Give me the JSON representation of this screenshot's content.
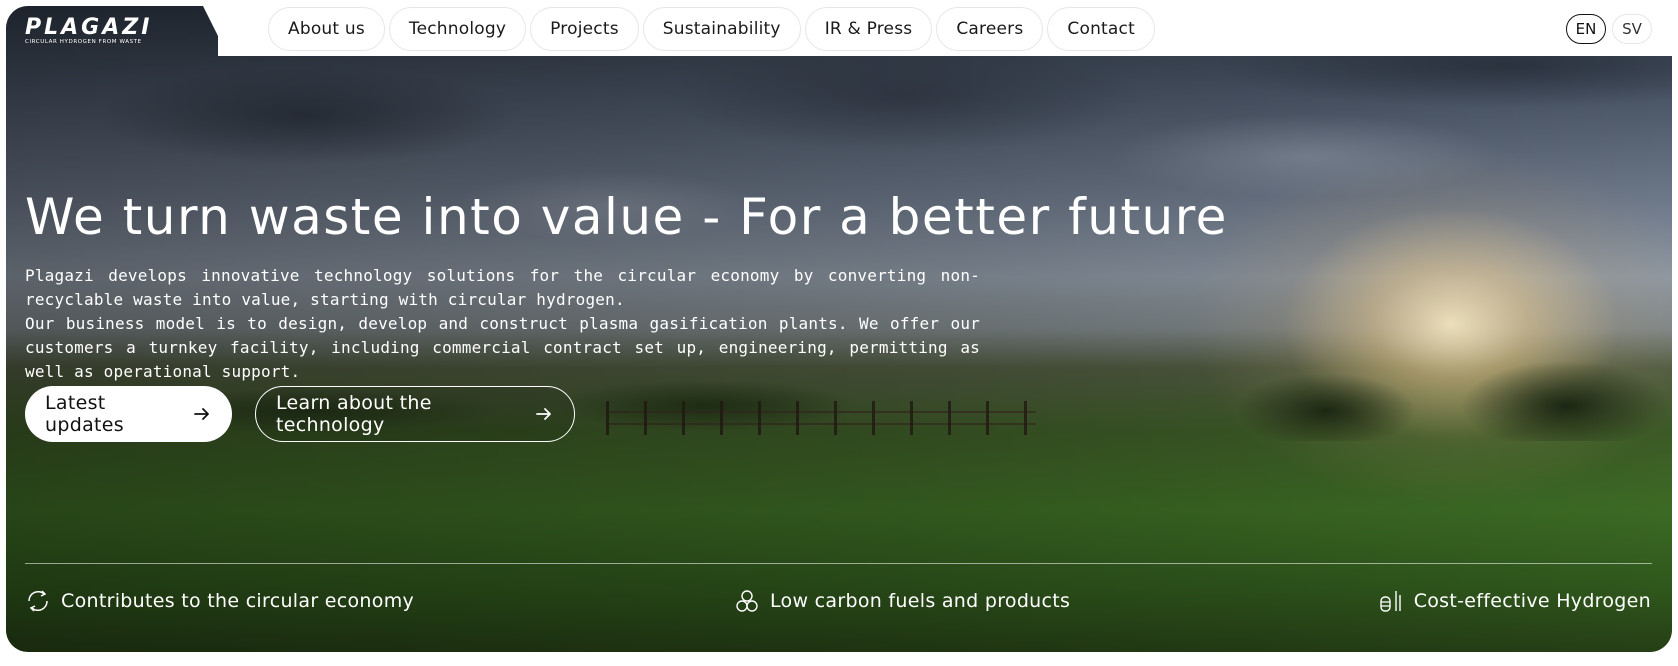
{
  "brand": {
    "name": "PLAGAZI",
    "tagline": "CIRCULAR HYDROGEN FROM WASTE"
  },
  "nav": {
    "items": [
      {
        "label": "About us"
      },
      {
        "label": "Technology"
      },
      {
        "label": "Projects"
      },
      {
        "label": "Sustainability"
      },
      {
        "label": "IR & Press"
      },
      {
        "label": "Careers"
      },
      {
        "label": "Contact"
      }
    ],
    "languages": [
      {
        "label": "EN",
        "active": true
      },
      {
        "label": "SV",
        "active": false
      }
    ]
  },
  "hero": {
    "headline": "We turn waste into value - For a better future",
    "paragraph_1": "Plagazi develops innovative technology solutions for the circular economy by converting non-recyclable waste into value, starting with circular hydrogen.",
    "paragraph_2": "Our business model is to design, develop and construct plasma gasification plants. We offer our customers a turnkey facility, including commercial contract set up, engineering, permitting as well as operational support.",
    "primary_button": "Latest updates",
    "secondary_button": "Learn about the technology"
  },
  "features": [
    {
      "label": "Contributes to the circular economy",
      "icon": "recycle-arrows-icon"
    },
    {
      "label": "Low carbon fuels and products",
      "icon": "molecule-icon"
    },
    {
      "label": "Cost-effective Hydrogen",
      "icon": "cylinders-icon"
    }
  ],
  "colors": {
    "text_on_hero": "#ffffff",
    "nav_bg": "#ffffff",
    "nav_border": "#e6e6e6"
  }
}
